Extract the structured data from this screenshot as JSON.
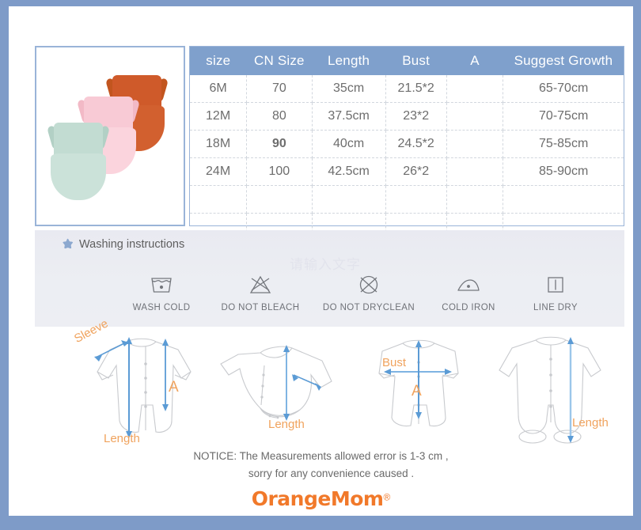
{
  "colors": {
    "outer_border": "#7e9bc8",
    "photo_frame_border": "#9ab4d8",
    "table_header_bg": "#7fa0cc",
    "table_header_text": "#ffffff",
    "table_cell_text": "#6d6d6d",
    "wash_panel_bg": "#e9eaf1",
    "measure_label": "#f0a35e",
    "measure_arrow": "#5b9bd5",
    "logo_orange": "#f1792a",
    "romper_rust": "#cf5a2a",
    "romper_pink": "#f8cad5",
    "romper_mint": "#c2dcd2"
  },
  "product_photo": {
    "alt": "three ruffled baby rompers",
    "items": [
      {
        "name": "romper-rust",
        "color": "#cf5a2a"
      },
      {
        "name": "romper-pink",
        "color": "#f8cad5"
      },
      {
        "name": "romper-mint",
        "color": "#c2dcd2"
      }
    ]
  },
  "size_table": {
    "headers": [
      "size",
      "CN Size",
      "Length",
      "Bust",
      "A",
      "Suggest Growth"
    ],
    "rows": [
      [
        "6M",
        "70",
        "35cm",
        "21.5*2",
        "",
        "65-70cm"
      ],
      [
        "12M",
        "80",
        "37.5cm",
        "23*2",
        "",
        "70-75cm"
      ],
      [
        "18M",
        "90",
        "40cm",
        "24.5*2",
        "",
        "75-85cm"
      ],
      [
        "24M",
        "100",
        "42.5cm",
        "26*2",
        "",
        "85-90cm"
      ],
      [
        "",
        "",
        "",
        "",
        "",
        ""
      ],
      [
        "",
        "",
        "",
        "",
        "",
        ""
      ]
    ],
    "emphasized_cells": [
      [
        2,
        1
      ]
    ]
  },
  "washing": {
    "title": "Washing instructions",
    "star_icon": "star-icon",
    "watermark": "请输入文字",
    "items": [
      {
        "icon": "wash-cold-icon",
        "label": "WASH COLD"
      },
      {
        "icon": "do-not-bleach-icon",
        "label": "DO NOT BLEACH"
      },
      {
        "icon": "do-not-dryclean-icon",
        "label": "DO NOT DRYCLEAN"
      },
      {
        "icon": "cold-iron-icon",
        "label": "COLD IRON"
      },
      {
        "icon": "line-dry-icon",
        "label": "LINE DRY"
      }
    ]
  },
  "garments": [
    {
      "name": "long-sleeve-footless-romper",
      "labels": {
        "sleeve": "Sleeve",
        "a": "A",
        "length": "Length"
      }
    },
    {
      "name": "long-sleeve-bodysuit",
      "labels": {
        "length": "Length"
      }
    },
    {
      "name": "short-sleeve-romper",
      "labels": {
        "bust": "Bust",
        "a": "A"
      }
    },
    {
      "name": "long-sleeve-footed-romper",
      "labels": {
        "length": "Length"
      }
    }
  ],
  "notice": {
    "line1": "NOTICE:   The Measurements allowed error is 1-3 cm ,",
    "line2": "sorry for any convenience caused ."
  },
  "logo": {
    "word": "OrangeMom",
    "registered": "®"
  }
}
